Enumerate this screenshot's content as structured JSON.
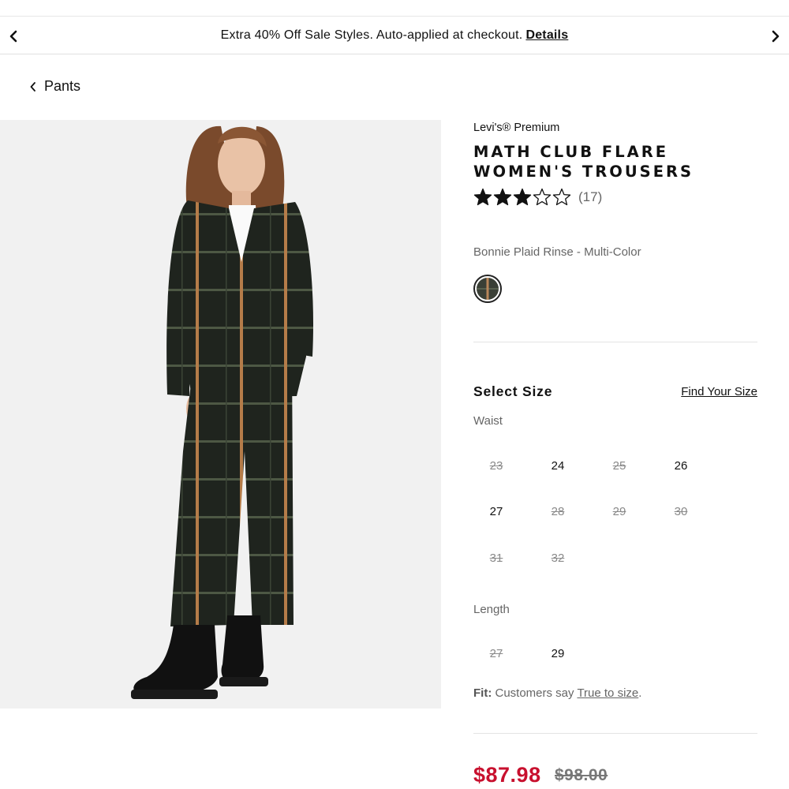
{
  "promo": {
    "text": "Extra 40% Off Sale Styles. Auto-applied at checkout.",
    "details_label": "Details",
    "prev_icon": "chevron-left-icon",
    "next_icon": "chevron-right-icon"
  },
  "breadcrumb": {
    "label": "Pants",
    "icon": "chevron-left-icon"
  },
  "product": {
    "brand": "Levi's® Premium",
    "title": "MATH CLUB FLARE WOMEN'S TROUSERS",
    "rating": 3,
    "rating_max": 5,
    "review_count": "(17)",
    "color_name": "Bonnie Plaid Rinse - Multi-Color",
    "price_sale": "$87.98",
    "price_original": "$98.00"
  },
  "size": {
    "heading": "Select Size",
    "find_your_size": "Find Your Size",
    "waist_label": "Waist",
    "waist": [
      {
        "label": "23",
        "available": false
      },
      {
        "label": "24",
        "available": true
      },
      {
        "label": "25",
        "available": false
      },
      {
        "label": "26",
        "available": true
      },
      {
        "label": "27",
        "available": true
      },
      {
        "label": "28",
        "available": false
      },
      {
        "label": "29",
        "available": false
      },
      {
        "label": "30",
        "available": false
      },
      {
        "label": "31",
        "available": false
      },
      {
        "label": "32",
        "available": false
      }
    ],
    "length_label": "Length",
    "length": [
      {
        "label": "27",
        "available": false
      },
      {
        "label": "29",
        "available": true
      }
    ]
  },
  "fit": {
    "label": "Fit:",
    "text": "Customers say",
    "link": "True to size",
    "end": "."
  },
  "colors": {
    "sale_price": "#c8102e",
    "text": "#111111",
    "muted": "#666666"
  }
}
